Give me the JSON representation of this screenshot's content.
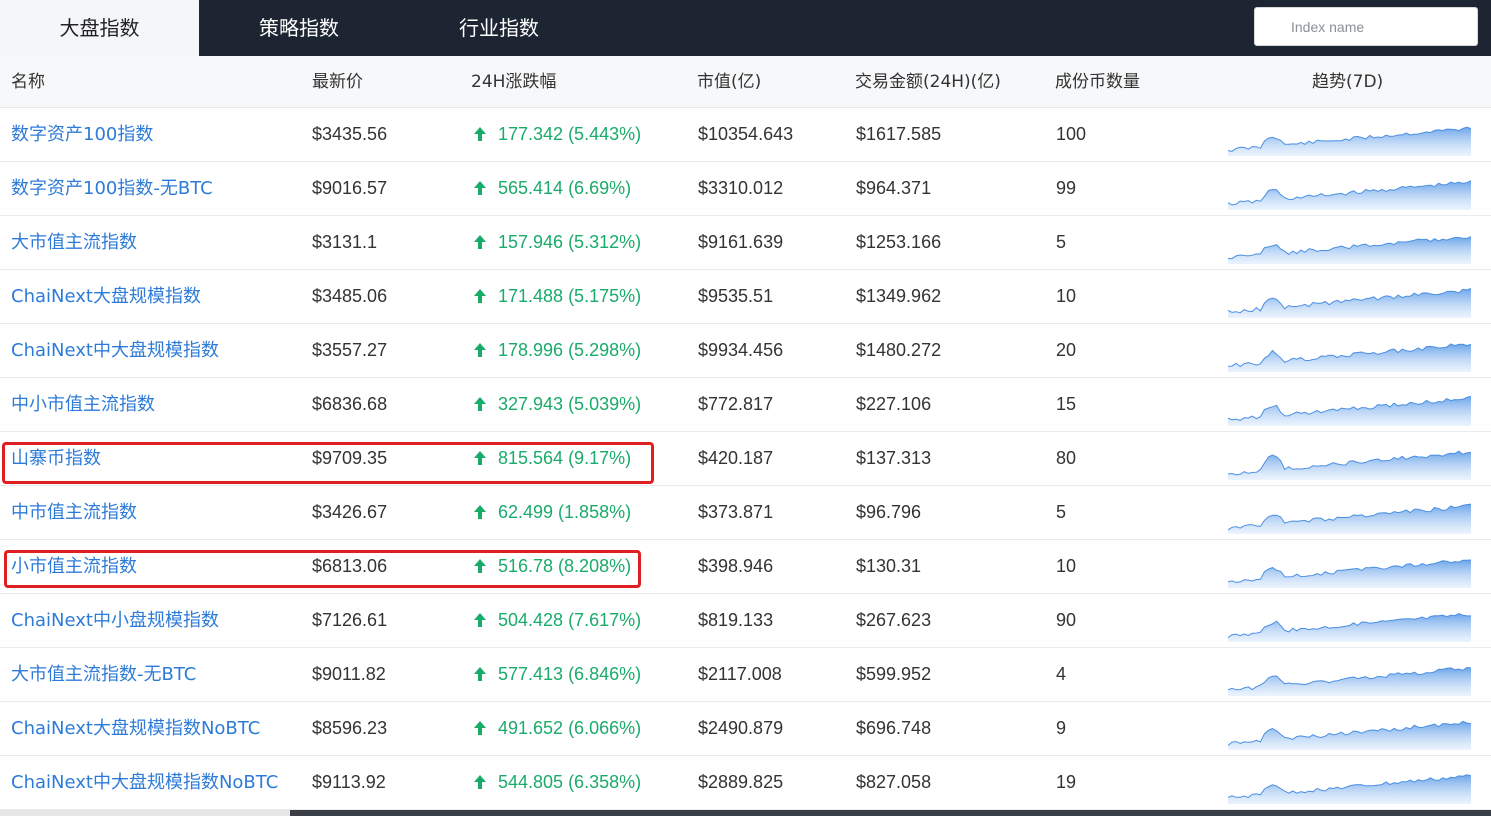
{
  "tabs": [
    "大盘指数",
    "策略指数",
    "行业指数"
  ],
  "search": {
    "placeholder": "Index name"
  },
  "columns": {
    "name": "名称",
    "price": "最新价",
    "change": "24H涨跌幅",
    "market_cap": "市值(亿)",
    "volume": "交易金额(24H)(亿)",
    "count": "成份币数量",
    "trend": "趋势(7D)"
  },
  "colors": {
    "link": "#2d7bd8",
    "up": "#1aab6a",
    "highlight": "#e02020",
    "header_bg": "#1d2532"
  },
  "rows": [
    {
      "name": "数字资产100指数",
      "price": "$3435.56",
      "change": "177.342 (5.443%)",
      "market_cap": "$10354.643",
      "volume": "$1617.585",
      "count": "100"
    },
    {
      "name": "数字资产100指数-无BTC",
      "price": "$9016.57",
      "change": "565.414 (6.69%)",
      "market_cap": "$3310.012",
      "volume": "$964.371",
      "count": "99"
    },
    {
      "name": "大市值主流指数",
      "price": "$3131.1",
      "change": "157.946 (5.312%)",
      "market_cap": "$9161.639",
      "volume": "$1253.166",
      "count": "5"
    },
    {
      "name": "ChaiNext大盘规模指数",
      "price": "$3485.06",
      "change": "171.488 (5.175%)",
      "market_cap": "$9535.51",
      "volume": "$1349.962",
      "count": "10"
    },
    {
      "name": "ChaiNext中大盘规模指数",
      "price": "$3557.27",
      "change": "178.996 (5.298%)",
      "market_cap": "$9934.456",
      "volume": "$1480.272",
      "count": "20"
    },
    {
      "name": "中小市值主流指数",
      "price": "$6836.68",
      "change": "327.943 (5.039%)",
      "market_cap": "$772.817",
      "volume": "$227.106",
      "count": "15"
    },
    {
      "name": "山寨币指数",
      "price": "$9709.35",
      "change": "815.564 (9.17%)",
      "market_cap": "$420.187",
      "volume": "$137.313",
      "count": "80",
      "highlighted": true
    },
    {
      "name": "中市值主流指数",
      "price": "$3426.67",
      "change": "62.499 (1.858%)",
      "market_cap": "$373.871",
      "volume": "$96.796",
      "count": "5"
    },
    {
      "name": "小市值主流指数",
      "price": "$6813.06",
      "change": "516.78 (8.208%)",
      "market_cap": "$398.946",
      "volume": "$130.31",
      "count": "10",
      "highlighted": true
    },
    {
      "name": "ChaiNext中小盘规模指数",
      "price": "$7126.61",
      "change": "504.428 (7.617%)",
      "market_cap": "$819.133",
      "volume": "$267.623",
      "count": "90"
    },
    {
      "name": "大市值主流指数-无BTC",
      "price": "$9011.82",
      "change": "577.413 (6.846%)",
      "market_cap": "$2117.008",
      "volume": "$599.952",
      "count": "4"
    },
    {
      "name": "ChaiNext大盘规模指数NoBTC",
      "price": "$8596.23",
      "change": "491.652 (6.066%)",
      "market_cap": "$2490.879",
      "volume": "$696.748",
      "count": "9"
    },
    {
      "name": "ChaiNext中大盘规模指数NoBTC",
      "price": "$9113.92",
      "change": "544.805 (6.358%)",
      "market_cap": "$2889.825",
      "volume": "$827.058",
      "count": "19"
    }
  ]
}
